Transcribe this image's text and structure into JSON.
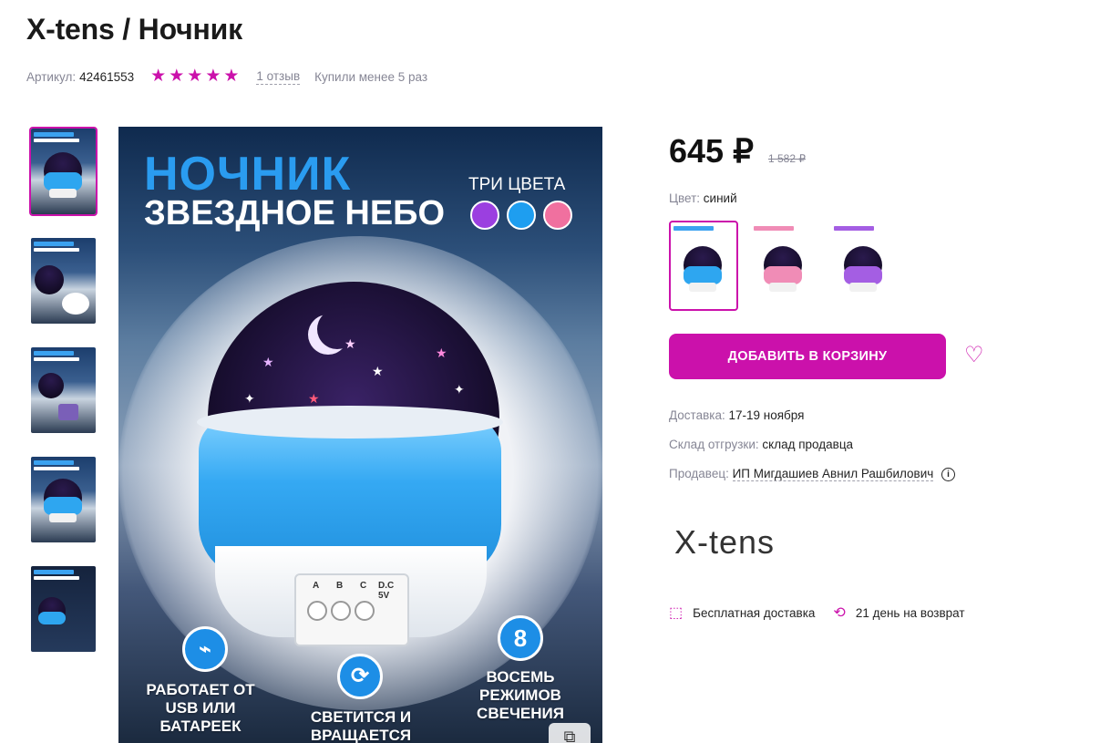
{
  "product": {
    "title": "X-tens / Ночник",
    "article_label": "Артикул:",
    "article": "42461553",
    "rating": 5,
    "reviews": "1 отзыв",
    "bought": "Купили менее 5 раз"
  },
  "gallery": {
    "thumbnails": [
      "thumb-1",
      "thumb-2",
      "thumb-3",
      "thumb-4",
      "thumb-5"
    ],
    "active_index": 0,
    "main_image": {
      "heading1": "НОЧНИК",
      "heading2": "ЗВЕЗДНОЕ НЕБО",
      "colors_label": "ТРИ ЦВЕТА",
      "dot_colors": [
        "#9b3fe0",
        "#1e9ef0",
        "#f0709f"
      ],
      "panel_labels": [
        "A",
        "B",
        "C",
        "D.C 5V"
      ],
      "badge_number": "8",
      "caption_left": "РАБОТАЕТ ОТ USB ИЛИ БАТАРЕЕК",
      "caption_middle": "СВЕТИТСЯ И ВРАЩАЕТСЯ",
      "caption_right": "ВОСЕМЬ РЕЖИМОВ СВЕЧЕНИЯ"
    }
  },
  "buybox": {
    "price": "645 ₽",
    "old_price": "1 582 ₽",
    "color_label": "Цвет:",
    "color_value": "синий",
    "variants": [
      "синий",
      "розовый",
      "фиолетовый"
    ],
    "add_to_cart": "ДОБАВИТЬ В КОРЗИНУ",
    "delivery_label": "Доставка:",
    "delivery_value": "17-19 ноября",
    "warehouse_label": "Склад отгрузки:",
    "warehouse_value": "склад продавца",
    "seller_label": "Продавец:",
    "seller_value": "ИП Мигдашиев Авнил Рашбилович",
    "brand": "X-tens",
    "perk1": "Бесплатная доставка",
    "perk2": "21 день на возврат"
  },
  "colors": {
    "accent": "#cb11ab"
  }
}
